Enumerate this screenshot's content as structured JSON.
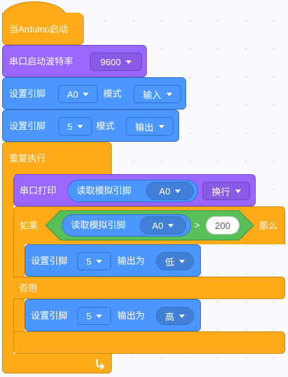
{
  "colors": {
    "control": "#ffab19",
    "serial": "#9966ff",
    "pin": "#4c97ff",
    "operator": "#59c059"
  },
  "hat": {
    "label": "当Arduino启动"
  },
  "serial_begin": {
    "label": "串口启动波特率",
    "baud": "9600"
  },
  "pin_mode_1": {
    "label": "设置引脚",
    "pin": "A0",
    "mode_label": "模式",
    "mode": "输入"
  },
  "pin_mode_2": {
    "label": "设置引脚",
    "pin": "5",
    "mode_label": "模式",
    "mode": "输出"
  },
  "forever": {
    "label": "重复执行",
    "loop_icon": "loop-arrow-icon"
  },
  "serial_print": {
    "label": "串口打印",
    "reporter_label": "读取模拟引脚",
    "reporter_pin": "A0",
    "newline": "换行"
  },
  "if_else": {
    "if_label": "如果",
    "then_label": "那么",
    "else_label": "否则",
    "condition": {
      "reporter_label": "读取模拟引脚",
      "reporter_pin": "A0",
      "operator": ">",
      "value": "200"
    }
  },
  "write_high_low_1": {
    "label": "设置引脚",
    "pin": "5",
    "output_label": "输出为",
    "level": "低"
  },
  "write_high_low_2": {
    "label": "设置引脚",
    "pin": "5",
    "output_label": "输出为",
    "level": "高"
  }
}
